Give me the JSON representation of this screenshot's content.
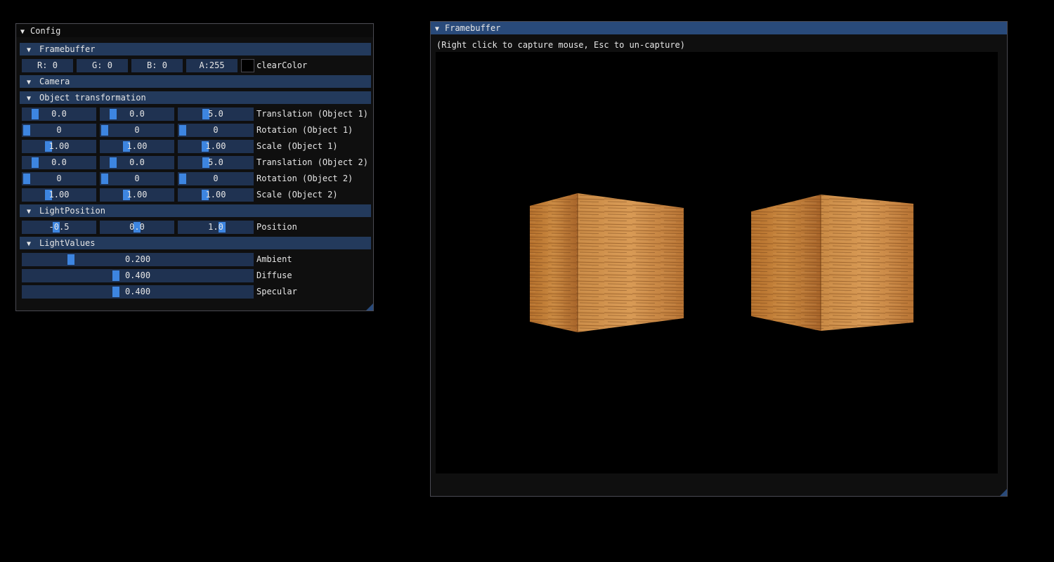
{
  "config_window": {
    "title": "Config",
    "sections": {
      "framebuffer": "Framebuffer",
      "camera": "Camera",
      "object_transformation": "Object transformation",
      "light_position": "LightPosition",
      "light_values": "LightValues"
    },
    "clear_color": {
      "r": "R:  0",
      "g": "G:  0",
      "b": "B:  0",
      "a": "A:255",
      "label": "clearColor",
      "swatch_color": "#000000"
    },
    "transform_rows": [
      {
        "values": [
          "0.0",
          "0.0",
          "5.0"
        ],
        "label": "Translation (Object 1)"
      },
      {
        "values": [
          "0",
          "0",
          "0"
        ],
        "label": "Rotation (Object 1)"
      },
      {
        "values": [
          "1.00",
          "1.00",
          "1.00"
        ],
        "label": "Scale (Object 1)"
      },
      {
        "values": [
          "0.0",
          "0.0",
          "5.0"
        ],
        "label": "Translation (Object 2)"
      },
      {
        "values": [
          "0",
          "0",
          "0"
        ],
        "label": "Rotation (Object 2)"
      },
      {
        "values": [
          "1.00",
          "1.00",
          "1.00"
        ],
        "label": "Scale (Object 2)"
      }
    ],
    "light_position": {
      "values": [
        "-0.5",
        "0.0",
        "1.0"
      ],
      "label": "Position"
    },
    "light_values": [
      {
        "value": "0.200",
        "label": "Ambient",
        "fraction": 0.2
      },
      {
        "value": "0.400",
        "label": "Diffuse",
        "fraction": 0.4
      },
      {
        "value": "0.400",
        "label": "Specular",
        "fraction": 0.4
      }
    ]
  },
  "framebuffer_window": {
    "title": "Framebuffer",
    "hint": "(Right click to capture mouse, Esc to un-capture)",
    "scene_objects": [
      "wooden-crate-object-1",
      "wooden-crate-object-2"
    ]
  },
  "colors": {
    "window_bg": "#0f0f0f",
    "section_header": "#233a5c",
    "field_bg": "#1f3251",
    "slider_grab": "#3d85e0",
    "active_title": "#294a7a"
  }
}
